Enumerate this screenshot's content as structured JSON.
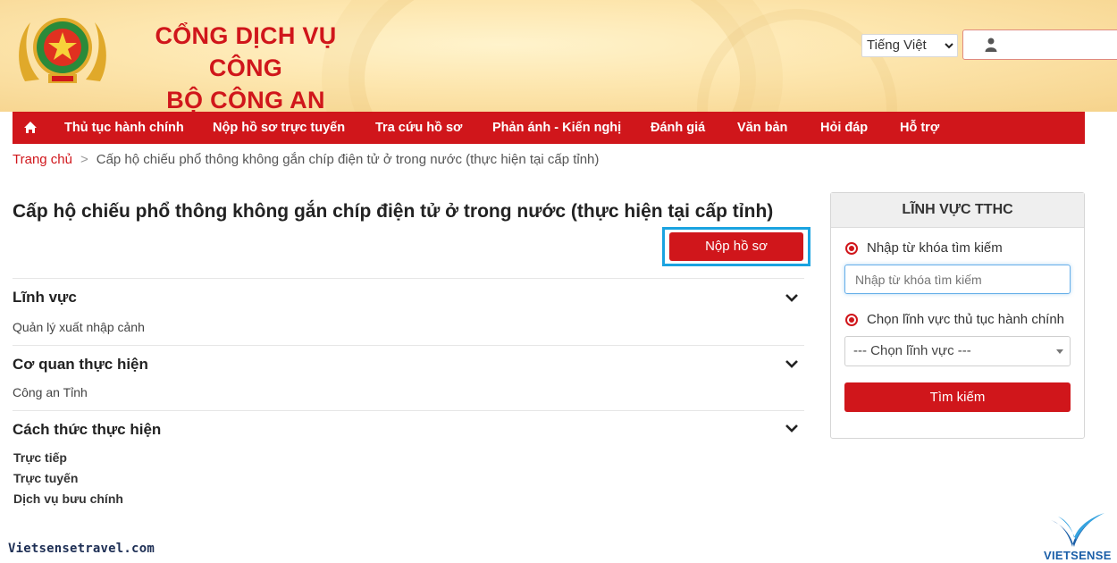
{
  "header": {
    "brand_line1": "CỔNG DỊCH VỤ CÔNG",
    "brand_line2": "BỘ CÔNG AN",
    "language": "Tiếng Việt",
    "user_value": ""
  },
  "nav": {
    "items": [
      "Thủ tục hành chính",
      "Nộp hồ sơ trực tuyến",
      "Tra cứu hồ sơ",
      "Phản ánh - Kiến nghị",
      "Đánh giá",
      "Văn bản",
      "Hỏi đáp",
      "Hỗ trợ"
    ]
  },
  "breadcrumb": {
    "home": "Trang chủ",
    "separator": ">",
    "current": "Cấp hộ chiếu phổ thông không gắn chíp điện tử ở trong nước (thực hiện tại cấp tỉnh)"
  },
  "main": {
    "title": "Cấp hộ chiếu phổ thông không gắn chíp điện tử ở trong nước (thực hiện tại cấp tỉnh)",
    "submit_label": "Nộp hồ sơ",
    "sections": [
      {
        "title": "Lĩnh vực",
        "value": "Quản lý xuất nhập cảnh"
      },
      {
        "title": "Cơ quan thực hiện",
        "value": "Công an Tỉnh"
      },
      {
        "title": "Cách thức thực hiện",
        "values": [
          "Trực tiếp",
          "Trực tuyến",
          "Dịch vụ bưu chính"
        ]
      }
    ]
  },
  "sidebar": {
    "title": "LĨNH VỰC TTHC",
    "keyword_radio": "Nhập từ khóa tìm kiếm",
    "keyword_placeholder": "Nhập từ khóa tìm kiếm",
    "field_radio": "Chọn lĩnh vực thủ tục hành chính",
    "field_select": "--- Chọn lĩnh vực ---",
    "search_label": "Tìm kiếm"
  },
  "watermark": {
    "site": "Vietsensetravel.com",
    "logo_text": "VIETSENSE"
  },
  "colors": {
    "brand_red": "#d0161b",
    "highlight_blue": "#1aa3e0"
  },
  "icons": [
    "home-icon",
    "user-icon",
    "chevron-down-icon",
    "national-emblem"
  ]
}
